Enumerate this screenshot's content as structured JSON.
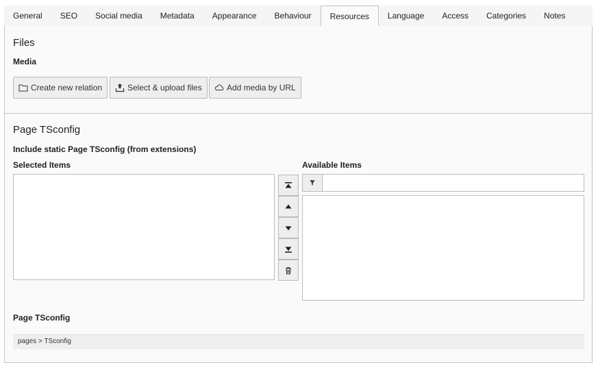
{
  "tabs": [
    "General",
    "SEO",
    "Social media",
    "Metadata",
    "Appearance",
    "Behaviour",
    "Resources",
    "Language",
    "Access",
    "Categories",
    "Notes"
  ],
  "active_tab": "Resources",
  "files": {
    "title": "Files",
    "media_label": "Media",
    "buttons": {
      "create_relation": "Create new relation",
      "select_upload": "Select & upload files",
      "add_media_url": "Add media by URL"
    }
  },
  "tsconfig": {
    "title": "Page TSconfig",
    "include_label": "Include static Page TSconfig (from extensions)",
    "selected_items_label": "Selected Items",
    "available_items_label": "Available Items",
    "filter_placeholder": "",
    "field_label": "Page TSconfig",
    "editor_breadcrumb": "pages > TSconfig"
  }
}
